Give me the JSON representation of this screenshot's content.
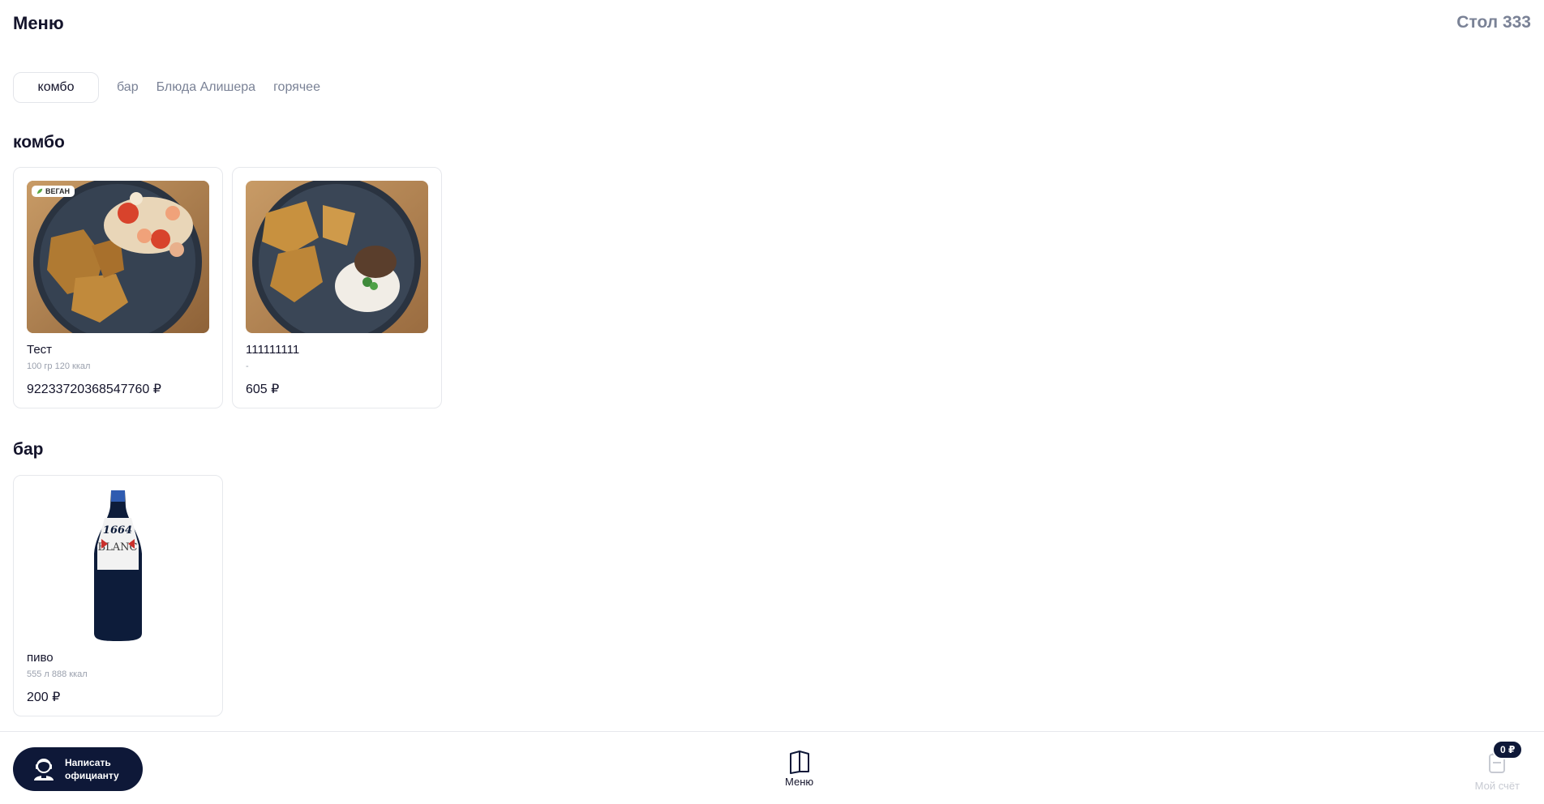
{
  "header": {
    "title": "Меню",
    "table": "Стол 333"
  },
  "tabs": [
    {
      "label": "комбо",
      "active": true
    },
    {
      "label": "бар",
      "active": false
    },
    {
      "label": "Блюда Алишера",
      "active": false
    },
    {
      "label": "горячее",
      "active": false
    }
  ],
  "sections": [
    {
      "title": "комбо",
      "items": [
        {
          "name": "Тест",
          "meta": "100 гр 120 ккал",
          "price": "92233720368547760 ₽",
          "badge": "ВЕГАН",
          "image": "pancakes-salad-plate"
        },
        {
          "name": "111111111",
          "meta": "-",
          "price": "605 ₽",
          "image": "pancakes-dessert-plate"
        }
      ]
    },
    {
      "title": "бар",
      "items": [
        {
          "name": "пиво",
          "meta": "555 л 888 ккал",
          "price": "200 ₽",
          "image": "beer-bottle",
          "bottle_text": "1664",
          "bottle_text2": "BLANC"
        }
      ]
    }
  ],
  "bottom_bar": {
    "waiter_button": "Написать\nофицианту",
    "menu_label": "Меню",
    "bill_label": "Мой счёт",
    "bill_amount": "0 ₽"
  },
  "colors": {
    "accent": "#0e1838",
    "muted": "#7a8296",
    "border": "#e6e8ec"
  }
}
